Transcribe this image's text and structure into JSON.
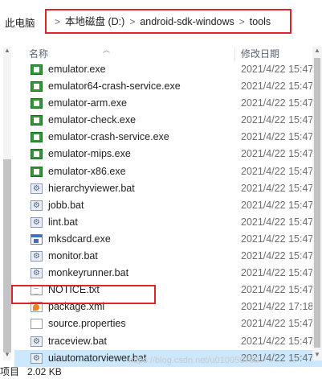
{
  "address": {
    "root": "此电脑",
    "crumbs": [
      "本地磁盘 (D:)",
      "android-sdk-windows",
      "tools"
    ],
    "separator": ">"
  },
  "columns": {
    "name": "名称",
    "date": "修改日期"
  },
  "files": [
    {
      "name": "emulator.exe",
      "date": "2021/4/22 15:47",
      "icon": "exe-icon"
    },
    {
      "name": "emulator64-crash-service.exe",
      "date": "2021/4/22 15:47",
      "icon": "exe-icon"
    },
    {
      "name": "emulator-arm.exe",
      "date": "2021/4/22 15:47",
      "icon": "exe-icon"
    },
    {
      "name": "emulator-check.exe",
      "date": "2021/4/22 15:47",
      "icon": "exe-icon"
    },
    {
      "name": "emulator-crash-service.exe",
      "date": "2021/4/22 15:47",
      "icon": "exe-icon"
    },
    {
      "name": "emulator-mips.exe",
      "date": "2021/4/22 15:47",
      "icon": "exe-icon"
    },
    {
      "name": "emulator-x86.exe",
      "date": "2021/4/22 15:47",
      "icon": "exe-icon"
    },
    {
      "name": "hierarchyviewer.bat",
      "date": "2021/4/22 15:47",
      "icon": "batch-file-icon"
    },
    {
      "name": "jobb.bat",
      "date": "2021/4/22 15:47",
      "icon": "batch-file-icon"
    },
    {
      "name": "lint.bat",
      "date": "2021/4/22 15:47",
      "icon": "batch-file-icon"
    },
    {
      "name": "mksdcard.exe",
      "date": "2021/4/22 15:47",
      "icon": "application-icon"
    },
    {
      "name": "monitor.bat",
      "date": "2021/4/22 15:47",
      "icon": "batch-file-icon"
    },
    {
      "name": "monkeyrunner.bat",
      "date": "2021/4/22 15:47",
      "icon": "batch-file-icon"
    },
    {
      "name": "NOTICE.txt",
      "date": "2021/4/22 15:47",
      "icon": "text-file-icon"
    },
    {
      "name": "package.xml",
      "date": "2021/4/22 17:18",
      "icon": "xml-file-icon"
    },
    {
      "name": "source.properties",
      "date": "2021/4/22 15:47",
      "icon": "properties-file-icon"
    },
    {
      "name": "traceview.bat",
      "date": "2021/4/22 15:47",
      "icon": "batch-file-icon"
    },
    {
      "name": "uiautomatorviewer.bat",
      "date": "2021/4/22 15:47",
      "icon": "batch-file-icon",
      "selected": true
    }
  ],
  "status": {
    "count": "项目",
    "size": "2.02 KB"
  },
  "watermark": "https://blog.csdn.net/u010059760"
}
